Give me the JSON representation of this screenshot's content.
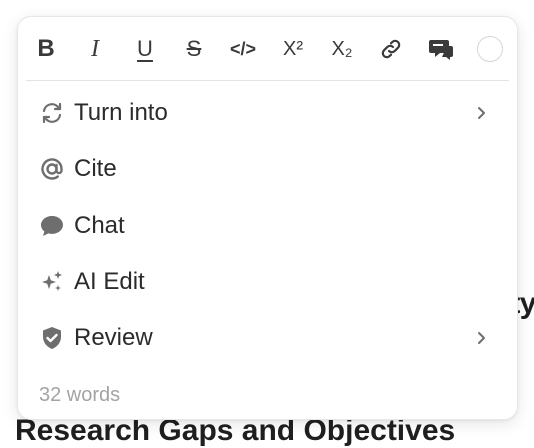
{
  "background": {
    "fragment_text": "ty",
    "heading": "Research Gaps and Objectives"
  },
  "toolbar": {
    "buttons": [
      {
        "name": "bold",
        "icon": "bold-icon",
        "glyph": "B"
      },
      {
        "name": "italic",
        "icon": "italic-icon",
        "glyph": "I"
      },
      {
        "name": "underline",
        "icon": "underline-icon",
        "glyph": "U"
      },
      {
        "name": "strikethrough",
        "icon": "strikethrough-icon",
        "glyph": "S"
      },
      {
        "name": "code",
        "icon": "code-icon",
        "glyph": "</>"
      },
      {
        "name": "superscript",
        "icon": "superscript-icon",
        "glyph": "X²"
      },
      {
        "name": "subscript",
        "icon": "subscript-icon",
        "glyph": "X₂"
      },
      {
        "name": "link",
        "icon": "link-icon"
      },
      {
        "name": "comment",
        "icon": "comment-icon"
      },
      {
        "name": "text-color",
        "icon": "color-swatch-icon"
      }
    ]
  },
  "menu": {
    "items": [
      {
        "label": "Turn into",
        "icon": "transform-icon",
        "has_submenu": true
      },
      {
        "label": "Cite",
        "icon": "at-sign-icon",
        "has_submenu": false
      },
      {
        "label": "Chat",
        "icon": "chat-bubble-icon",
        "has_submenu": false
      },
      {
        "label": "AI Edit",
        "icon": "sparkles-icon",
        "has_submenu": false
      },
      {
        "label": "Review",
        "icon": "shield-check-icon",
        "has_submenu": true
      }
    ],
    "word_count": "32 words"
  },
  "colors": {
    "icon": "#3a3a3a",
    "muted_icon": "#6e6e6e",
    "footer_text": "#a3a3a3",
    "border": "#e7e7e7"
  }
}
